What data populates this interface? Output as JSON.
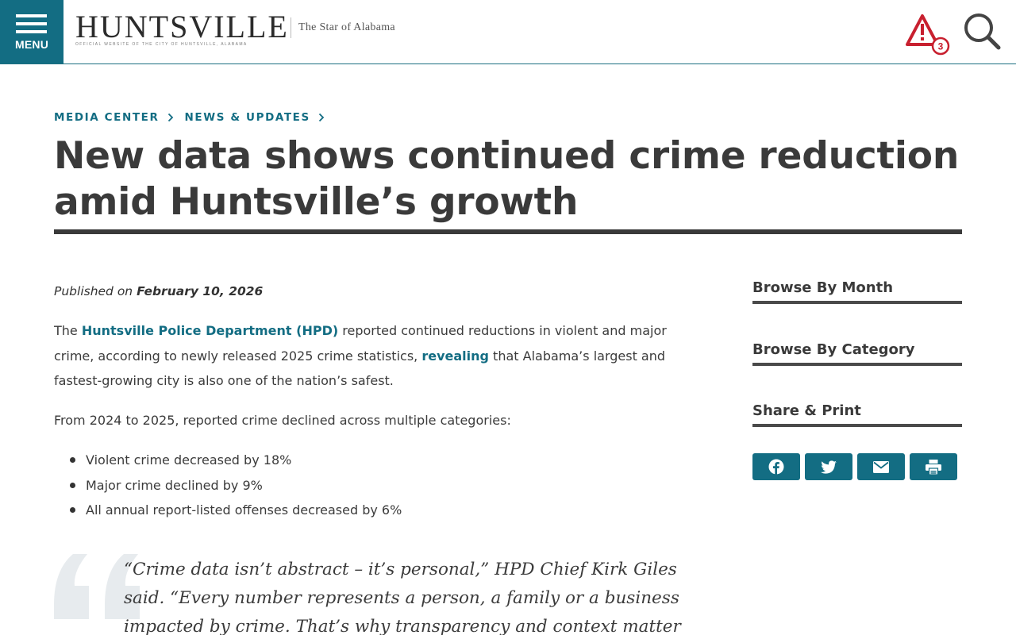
{
  "header": {
    "menu_label": "MENU",
    "logo_text": "HUNTSVILLE",
    "logo_subtitle": "OFFICIAL WEBSITE OF THE CITY OF HUNTSVILLE, ALABAMA",
    "tagline": "The Star of Alabama",
    "alert_count": "3"
  },
  "breadcrumb": {
    "items": [
      {
        "label": "MEDIA CENTER"
      },
      {
        "label": "NEWS & UPDATES"
      }
    ]
  },
  "article": {
    "title_line1": "New data shows continued crime reduction",
    "title_line2": "amid Huntsville’s growth",
    "published_prefix": "Published on ",
    "published_date": "February 10, 2026",
    "p1_part1": "The ",
    "p1_link1": "Huntsville Police Department (HPD)",
    "p1_part2": " reported continued reductions in violent and major crime, according to newly released 2025 crime statistics, ",
    "p1_link2": "revealing",
    "p1_part3": " that Alabama’s largest and fastest-growing city is also one of the nation’s safest.",
    "p2": "From 2024 to 2025, reported crime declined across multiple categories:",
    "bullets": [
      "Violent crime decreased by 18%",
      "Major crime declined by 9%",
      "All annual report-listed offenses decreased by 6%"
    ],
    "quote": "“Crime data isn’t abstract – it’s personal,” HPD Chief Kirk Giles said. “Every number represents a person, a family or a business impacted by crime. That’s why transparency and context matter"
  },
  "sidebar": {
    "browse_month": "Browse By Month",
    "browse_category": "Browse By Category",
    "share_print": "Share & Print"
  },
  "colors": {
    "brand_teal": "#136d83",
    "alert_red": "#c8202f",
    "heading_dark": "#3a3a3a"
  },
  "icons": {
    "menu": "hamburger-icon",
    "alert": "warning-triangle-icon",
    "search": "magnifier-icon",
    "share": [
      "facebook-icon",
      "twitter-icon",
      "email-icon",
      "print-icon"
    ]
  }
}
